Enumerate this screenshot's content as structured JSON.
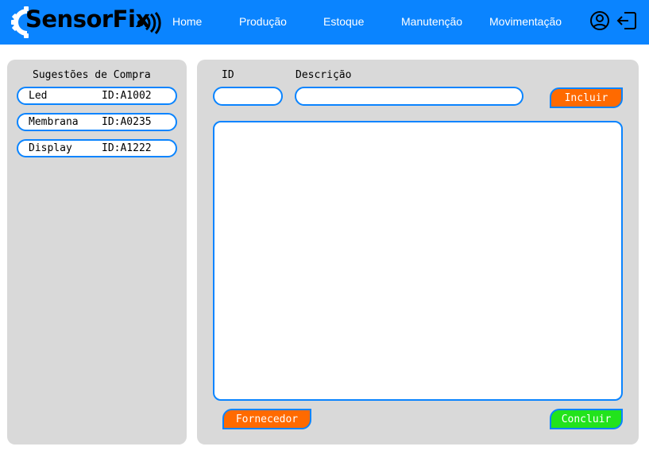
{
  "header": {
    "logo_text": "SensorFix",
    "nav": [
      "Home",
      "Produção",
      "Estoque",
      "Manutenção",
      "Movimentação"
    ],
    "icons": [
      "user-circle-icon",
      "logout-icon"
    ],
    "background_color": "#0a84ff"
  },
  "sidebar": {
    "title": "Sugestões de Compra",
    "items": [
      {
        "name": "Led",
        "id": "ID:A1002"
      },
      {
        "name": "Membrana",
        "id": "ID:A0235"
      },
      {
        "name": "Display",
        "id": "ID:A1222"
      }
    ]
  },
  "form": {
    "id_label": "ID",
    "id_value": "",
    "description_label": "Descrição",
    "description_value": "",
    "include_button": "Incluir",
    "list_content": ""
  },
  "footer": {
    "supplier_button": "Fornecedor",
    "finish_button": "Concluir"
  },
  "colors": {
    "accent": "#0a84ff",
    "panel": "#d9d9d9",
    "orange_button": "#ff6a00",
    "green_button": "#22e31c"
  }
}
